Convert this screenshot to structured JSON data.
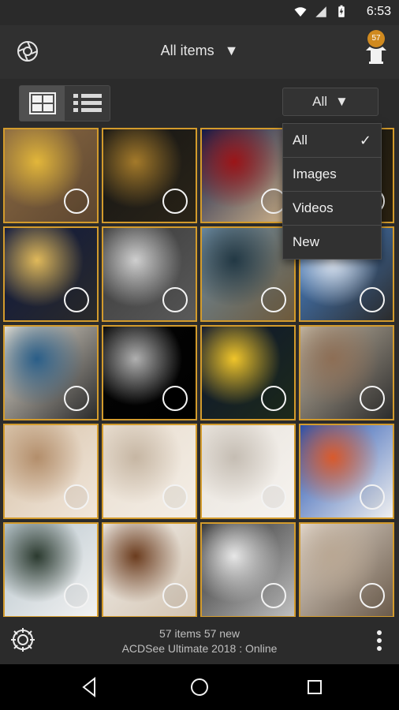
{
  "status_bar": {
    "time": "6:53"
  },
  "app_bar": {
    "title": "All items",
    "title_caret": "▼",
    "upload_badge": "57"
  },
  "toolbar": {
    "view_modes": [
      "grid",
      "list"
    ],
    "filter_label": "All",
    "filter_caret": "▼"
  },
  "filter_menu": {
    "items": [
      {
        "label": "All",
        "checked": true
      },
      {
        "label": "Images",
        "checked": false
      },
      {
        "label": "Videos",
        "checked": false
      },
      {
        "label": "New",
        "checked": false
      }
    ],
    "check_glyph": "✓"
  },
  "grid": {
    "items": [
      {
        "name": "maple-leaf-on-wood",
        "colors": [
          "#8b6a43",
          "#e2b63a",
          "#5d4630"
        ]
      },
      {
        "name": "bottles-in-dark",
        "colors": [
          "#151515",
          "#a47a2a",
          "#2a2418"
        ]
      },
      {
        "name": "red-flowers-blue-night",
        "colors": [
          "#0b1a4a",
          "#9b1518",
          "#d6b88c"
        ]
      },
      {
        "name": "wall-light",
        "colors": [
          "#1c1a12",
          "#b88d2d",
          "#2a2111"
        ]
      },
      {
        "name": "yellow-rose-blue",
        "colors": [
          "#0e1840",
          "#e0b95a",
          "#2a2a2a"
        ]
      },
      {
        "name": "seagull-over-water",
        "colors": [
          "#3a3a3a",
          "#cfcfcf",
          "#5a5a5a"
        ]
      },
      {
        "name": "coastline-island",
        "colors": [
          "#6a8aa2",
          "#223844",
          "#6e5a3b"
        ]
      },
      {
        "name": "bird-in-sky",
        "colors": [
          "#4a89d6",
          "#e7eef8",
          "#2b2b2b"
        ]
      },
      {
        "name": "island-in-sea",
        "colors": [
          "#e8e1d4",
          "#2a5e88",
          "#2b2b2b"
        ]
      },
      {
        "name": "moon-night",
        "colors": [
          "#050505",
          "#b0b0b0",
          "#000000"
        ]
      },
      {
        "name": "yellow-tulips-dark",
        "colors": [
          "#0d1630",
          "#f0c52a",
          "#1d2a1a"
        ]
      },
      {
        "name": "street-cars",
        "colors": [
          "#c2b6a2",
          "#8d6e55",
          "#2c2c2c"
        ]
      },
      {
        "name": "bathroom-interior",
        "colors": [
          "#d7c2a8",
          "#b38e6b",
          "#f1e7dc"
        ]
      },
      {
        "name": "open-book-pages",
        "colors": [
          "#e8ddcf",
          "#c6b6a3",
          "#f4eee6"
        ]
      },
      {
        "name": "bright-hallway",
        "colors": [
          "#e8e3dc",
          "#c5bdb3",
          "#f6f3ef"
        ]
      },
      {
        "name": "graffiti-mouth",
        "colors": [
          "#1f4fb0",
          "#d95a2c",
          "#f0f0f0"
        ]
      },
      {
        "name": "snowy-tree-cabin",
        "colors": [
          "#b7c5cc",
          "#2b3a2f",
          "#f2f2f2"
        ]
      },
      {
        "name": "cake-slice-plate",
        "colors": [
          "#f0ede8",
          "#6b3c1e",
          "#d3c4b2"
        ]
      },
      {
        "name": "white-paper-gradient",
        "colors": [
          "#2d2d2d",
          "#e7e7e7",
          "#bfbfbf"
        ]
      },
      {
        "name": "person-on-pier",
        "colors": [
          "#e2d8cd",
          "#b9a793",
          "#6b5b4b"
        ]
      }
    ]
  },
  "footer": {
    "line1": "57 items   57 new",
    "line2": "ACDSee Ultimate 2018 : Online"
  },
  "nav": {
    "back": "back",
    "home": "home",
    "recents": "recents"
  },
  "colors": {
    "accent": "#d39b2c",
    "background": "#2b2b2b",
    "appbar": "#303030"
  },
  "icons": {
    "logo": "acdsee-aperture-icon",
    "upload": "upload-icon",
    "grid_view": "grid-view-icon",
    "list_view": "list-view-icon",
    "settings": "gear-icon",
    "more": "more-vert-icon"
  }
}
